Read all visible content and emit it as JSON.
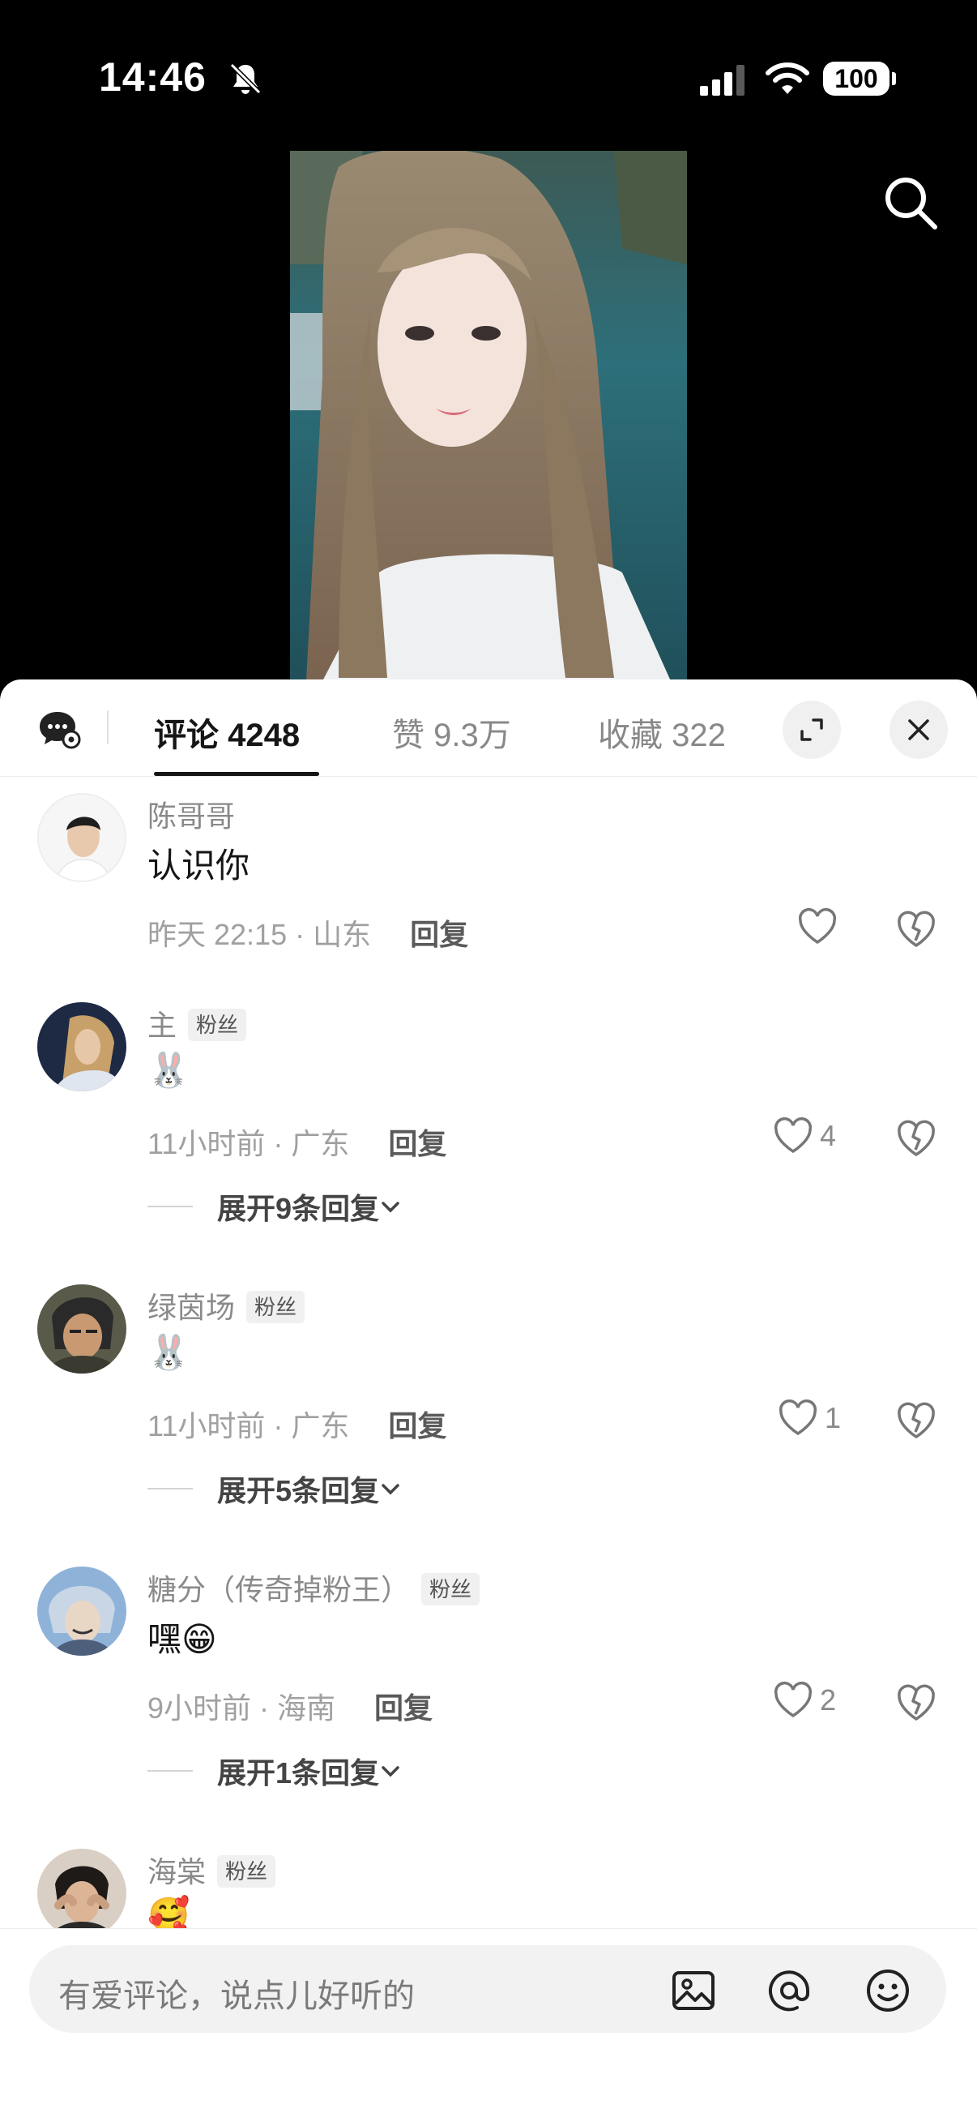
{
  "status_bar": {
    "time": "14:46",
    "battery": "100"
  },
  "tabs": {
    "comments": "评论 4248",
    "likes": "赞 9.3万",
    "favorites": "收藏 322"
  },
  "comments": [
    {
      "username": "陈哥哥",
      "badge": "",
      "content": "认识你",
      "meta": "昨天 22:15 · 山东",
      "reply": "回复",
      "likes": "",
      "expand": ""
    },
    {
      "username": "主",
      "badge": "粉丝",
      "content": "🐰",
      "meta": "11小时前 · 广东",
      "reply": "回复",
      "likes": "4",
      "expand": "展开9条回复"
    },
    {
      "username": "绿茵场",
      "badge": "粉丝",
      "content": "🐰",
      "meta": "11小时前 · 广东",
      "reply": "回复",
      "likes": "1",
      "expand": "展开5条回复"
    },
    {
      "username": "糖分（传奇掉粉王）",
      "badge": "粉丝",
      "content": "嘿😁",
      "meta": "9小时前 · 海南",
      "reply": "回复",
      "likes": "2",
      "expand": "展开1条回复"
    },
    {
      "username": "海棠",
      "badge": "粉丝",
      "content": "🥰",
      "meta": "",
      "reply": "",
      "likes": "",
      "expand": ""
    }
  ],
  "input": {
    "placeholder": "有爱评论，说点儿好听的"
  },
  "icons": [
    "mute-icon",
    "signal-icon",
    "wifi-icon",
    "search-icon",
    "comment-settings-icon",
    "expand-icon",
    "close-icon",
    "heart-icon",
    "broken-heart-icon",
    "chevron-down-icon",
    "image-icon",
    "at-icon",
    "emoji-icon"
  ]
}
